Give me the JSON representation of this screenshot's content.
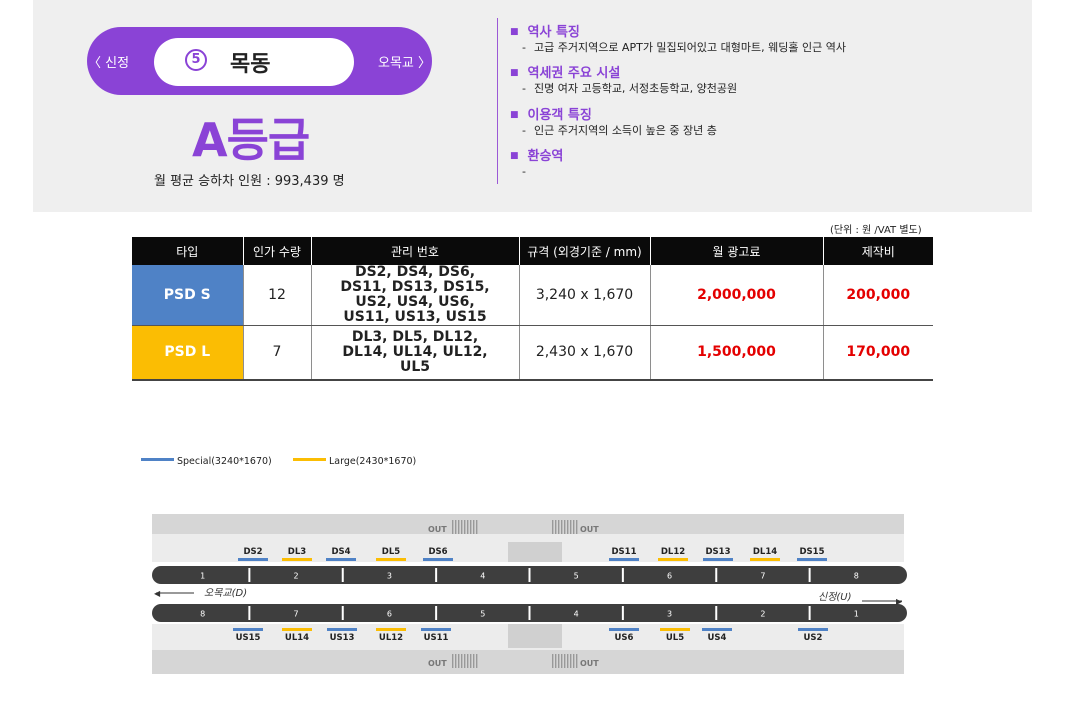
{
  "station": {
    "prev": "〈 신정",
    "next": "오목교 〉",
    "number": "5",
    "name": "목동",
    "grade": "A등급",
    "ridership": "월 평균 승하차 인원 :  993,439 명"
  },
  "info": [
    {
      "title": "역사 특징",
      "desc": "고급 주거지역으로 APT가 밀집되어있고 대형마트, 웨딩홀 인근 역사"
    },
    {
      "title": "역세권 주요 시설",
      "desc": "진명 여자 고등학교, 서정초등학교, 양천공원"
    },
    {
      "title": "이용객 특징",
      "desc": "인근 주거지역의 소득이 높은 중 장년 층"
    },
    {
      "title": "환승역",
      "desc": ""
    }
  ],
  "table": {
    "unit_note": "(단위 : 원 /VAT 별도)",
    "headers": [
      "타입",
      "인가 수량",
      "관리 번호",
      "규격 (외경기준 / mm)",
      "월 광고료",
      "제작비"
    ],
    "rows": [
      {
        "type": "PSD S",
        "qty": "12",
        "ids": "DS2, DS4, DS6, DS11, DS13, DS15, US2, US4, US6, US11, US13, US15",
        "spec": "3,240 x 1,670",
        "monthly": "2,000,000",
        "production": "200,000"
      },
      {
        "type": "PSD L",
        "qty": "7",
        "ids": "DL3, DL5, DL12, DL14, UL14, UL12, UL5",
        "spec": "2,430 x 1,670",
        "monthly": "1,500,000",
        "production": "170,000"
      }
    ],
    "colors": {
      "special": "#4f82c6",
      "large": "#fbbd03",
      "price": "#e40000"
    }
  },
  "legend": {
    "special": "Special(3240*1670)",
    "large": "Large(2430*1670)"
  },
  "map": {
    "out_label": "OUT",
    "direction_down": "오목교(D)",
    "direction_up": "신정(U)",
    "top_track_cars": [
      "1",
      "2",
      "3",
      "4",
      "5",
      "6",
      "7",
      "8"
    ],
    "bottom_track_cars": [
      "8",
      "7",
      "6",
      "5",
      "4",
      "3",
      "2",
      "1"
    ],
    "top_labels": [
      {
        "id": "DS2",
        "kind": "special"
      },
      {
        "id": "DL3",
        "kind": "large"
      },
      {
        "id": "DS4",
        "kind": "special"
      },
      {
        "id": "DL5",
        "kind": "large"
      },
      {
        "id": "DS6",
        "kind": "special"
      },
      {
        "id": "DS11",
        "kind": "special"
      },
      {
        "id": "DL12",
        "kind": "large"
      },
      {
        "id": "DS13",
        "kind": "special"
      },
      {
        "id": "DL14",
        "kind": "large"
      },
      {
        "id": "DS15",
        "kind": "special"
      }
    ],
    "bottom_labels": [
      {
        "id": "US15",
        "kind": "special"
      },
      {
        "id": "UL14",
        "kind": "large"
      },
      {
        "id": "US13",
        "kind": "special"
      },
      {
        "id": "UL12",
        "kind": "large"
      },
      {
        "id": "US11",
        "kind": "special"
      },
      {
        "id": "US6",
        "kind": "special"
      },
      {
        "id": "UL5",
        "kind": "large"
      },
      {
        "id": "US4",
        "kind": "special"
      },
      {
        "id": "US2",
        "kind": "special"
      }
    ]
  }
}
